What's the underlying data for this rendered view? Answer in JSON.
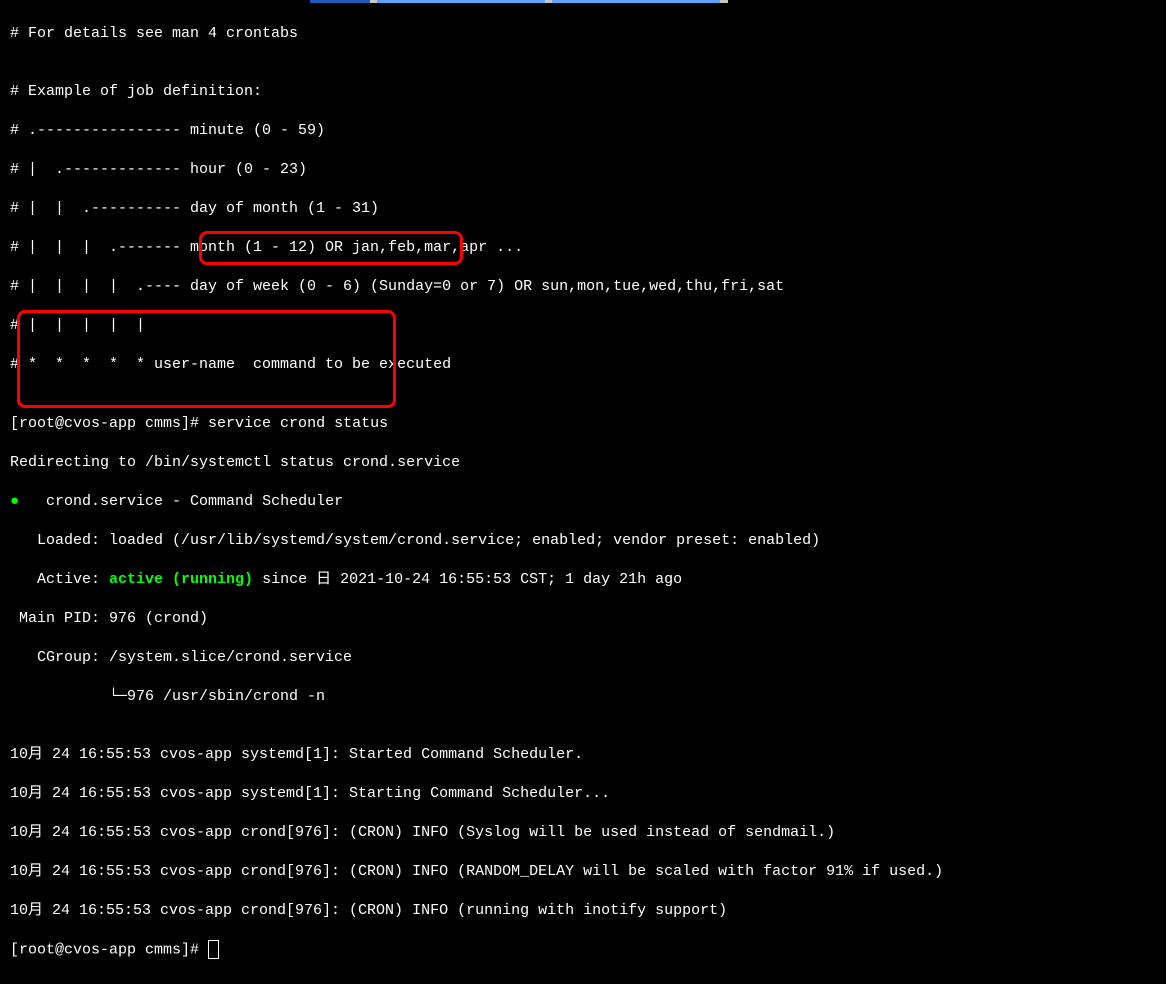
{
  "crontab": {
    "l0": "# For details see man 4 crontabs",
    "l1": "",
    "l2": "# Example of job definition:",
    "l3": "# .---------------- minute (0 - 59)",
    "l4": "# |  .------------- hour (0 - 23)",
    "l5": "# |  |  .---------- day of month (1 - 31)",
    "l6": "# |  |  |  .------- month (1 - 12) OR jan,feb,mar,apr ...",
    "l7": "# |  |  |  |  .---- day of week (0 - 6) (Sunday=0 or 7) OR sun,mon,tue,wed,thu,fri,sat",
    "l8": "# |  |  |  |  |",
    "l9": "# *  *  *  *  * user-name  command to be executed",
    "l10": ""
  },
  "prompt1": {
    "user": "[root@cvos-app cmms]# ",
    "command": "service crond status"
  },
  "output": {
    "redirect": "Redirecting to /bin/systemctl status crond.service",
    "dot_line_pre": "   ",
    "dot_line_post": "crond.service - Command Scheduler",
    "loaded": "   Loaded: loaded (/usr/lib/systemd/system/crond.service; enabled; vendor preset: enabled)",
    "active_pre": "   Active: ",
    "active_val": "active (running)",
    "active_post": " since 日 2021-10-24 16:55:53 CST; 1 day 21h ago",
    "mainpid": " Main PID: 976 (crond)",
    "cgroup": "   CGroup: /system.slice/crond.service",
    "cgroup_sub": "           └─976 /usr/sbin/crond -n",
    "blank": ""
  },
  "logs": {
    "l0": "10月 24 16:55:53 cvos-app systemd[1]: Started Command Scheduler.",
    "l1": "10月 24 16:55:53 cvos-app systemd[1]: Starting Command Scheduler...",
    "l2": "10月 24 16:55:53 cvos-app crond[976]: (CRON) INFO (Syslog will be used instead of sendmail.)",
    "l3": "10月 24 16:55:53 cvos-app crond[976]: (CRON) INFO (RANDOM_DELAY will be scaled with factor 91% if used.)",
    "l4": "10月 24 16:55:53 cvos-app crond[976]: (CRON) INFO (running with inotify support)"
  },
  "prompt2": {
    "text": "[root@cvos-app cmms]# "
  }
}
